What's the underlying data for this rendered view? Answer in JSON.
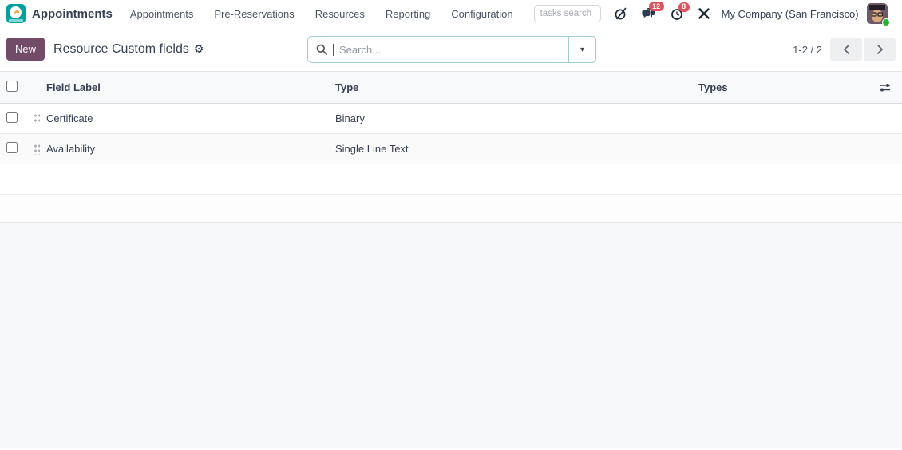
{
  "navbar": {
    "app_name": "Appointments",
    "menu_items": {
      "appointments": "Appointments",
      "pre_reservations": "Pre-Reservations",
      "resources": "Resources",
      "reporting": "Reporting",
      "configuration": "Configuration"
    },
    "tasks_search_placeholder": "tasks search",
    "messages_badge": "12",
    "activities_badge": "8",
    "company": "My Company (San Francisco)"
  },
  "control_panel": {
    "new_button": "New",
    "title": "Resource Custom fields",
    "search_placeholder": "Search...",
    "pager_value": "1-2 / 2"
  },
  "table": {
    "headers": {
      "field_label": "Field Label",
      "type": "Type",
      "types": "Types"
    },
    "rows": [
      {
        "field_label": "Certificate",
        "type": "Binary",
        "types": ""
      },
      {
        "field_label": "Availability",
        "type": "Single Line Text",
        "types": ""
      }
    ]
  },
  "icons": {
    "gear": "⚙",
    "caret_down": "▾"
  },
  "colors": {
    "accent_purple": "#714b67",
    "logo_teal": "#00a09d",
    "badge_red": "#e0535c",
    "search_border_teal": "#a3cdd1",
    "online_green": "#21b632",
    "header_bg": "#f8f9fb"
  }
}
